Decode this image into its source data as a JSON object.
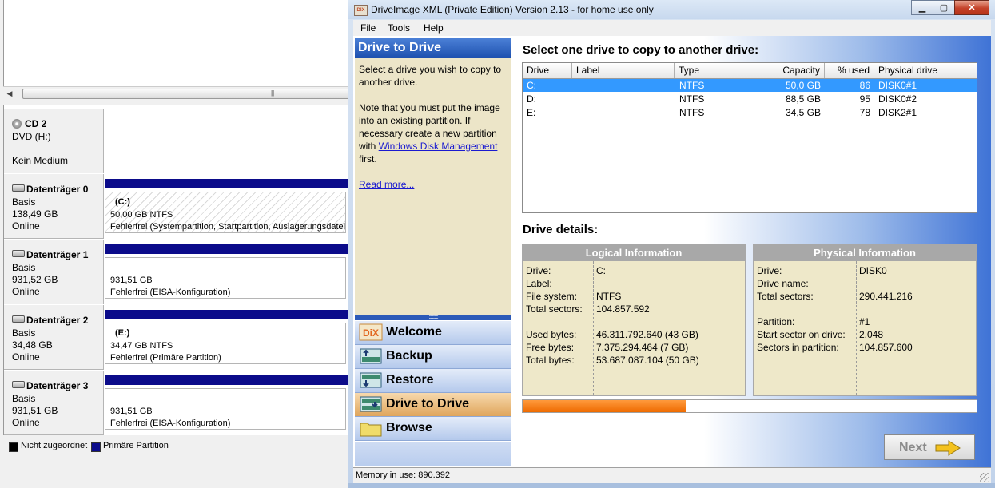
{
  "disk_management": {
    "scroll_grip": "|||",
    "disks": [
      {
        "name": "CD 2",
        "line1": "DVD (H:)",
        "line2": "",
        "line3": "Kein Medium",
        "part_title": "",
        "part_size": "",
        "part_status": ""
      },
      {
        "name": "Datenträger 0",
        "line1": "Basis",
        "line2": "138,49 GB",
        "line3": "Online",
        "part_title": "(C:)",
        "part_size": "50,00 GB NTFS",
        "part_status": "Fehlerfrei (Systempartition, Startpartition, Auslagerungsdatei"
      },
      {
        "name": "Datenträger 1",
        "line1": "Basis",
        "line2": "931,52 GB",
        "line3": "Online",
        "part_title": "",
        "part_size": "931,51 GB",
        "part_status": "Fehlerfrei (EISA-Konfiguration)"
      },
      {
        "name": "Datenträger 2",
        "line1": "Basis",
        "line2": "34,48 GB",
        "line3": "Online",
        "part_title": "(E:)",
        "part_size": "34,47 GB NTFS",
        "part_status": "Fehlerfrei (Primäre Partition)"
      },
      {
        "name": "Datenträger 3",
        "line1": "Basis",
        "line2": "931,51 GB",
        "line3": "Online",
        "part_title": "",
        "part_size": "931,51 GB",
        "part_status": "Fehlerfrei (EISA-Konfiguration)"
      }
    ],
    "legend": [
      {
        "label": "Nicht zugeordnet",
        "color": "#000000"
      },
      {
        "label": "Primäre Partition",
        "color": "#0b0b8a"
      }
    ]
  },
  "window": {
    "title": "DriveImage XML (Private Edition) Version 2.13 - for home use only",
    "icon_text": "DIX"
  },
  "menu": {
    "file": "File",
    "tools": "Tools",
    "help": "Help"
  },
  "sidebar": {
    "header": "Drive to Drive",
    "intro": "Select a drive you wish to copy to another drive.",
    "note_before_link": "Note that you must put the image into an existing partition. If necessary create a new partition with ",
    "link": "Windows Disk Management",
    "note_after_link": " first.",
    "read_more": "Read more...",
    "grip": "::::::::::::",
    "nav": [
      {
        "label": "Welcome",
        "icon": "dix-logo-icon"
      },
      {
        "label": "Backup",
        "icon": "backup-icon"
      },
      {
        "label": "Restore",
        "icon": "restore-icon"
      },
      {
        "label": "Drive to Drive",
        "icon": "drive-to-drive-icon",
        "active": true
      },
      {
        "label": "Browse",
        "icon": "folder-icon"
      }
    ]
  },
  "main": {
    "select_title": "Select one drive to copy to another drive:",
    "columns": [
      "Drive",
      "Label",
      "Type",
      "Capacity",
      "% used",
      "Physical drive"
    ],
    "drives": [
      {
        "drive": "C:",
        "label": "",
        "type": "NTFS",
        "capacity": "50,0 GB",
        "used": "86",
        "physical": "DISK0#1",
        "selected": true
      },
      {
        "drive": "D:",
        "label": "",
        "type": "NTFS",
        "capacity": "88,5 GB",
        "used": "95",
        "physical": "DISK0#2"
      },
      {
        "drive": "E:",
        "label": "",
        "type": "NTFS",
        "capacity": "34,5 GB",
        "used": "78",
        "physical": "DISK2#1"
      }
    ],
    "details_title": "Drive details:",
    "logical": {
      "header": "Logical Information",
      "rows": [
        {
          "k": "Drive:",
          "v": "C:"
        },
        {
          "k": "Label:",
          "v": ""
        },
        {
          "k": "File system:",
          "v": "NTFS"
        },
        {
          "k": "Total sectors:",
          "v": "104.857.592"
        },
        {
          "k": "Used bytes:",
          "v": "46.311.792.640 (43 GB)"
        },
        {
          "k": "Free bytes:",
          "v": "7.375.294.464 (7 GB)"
        },
        {
          "k": "Total bytes:",
          "v": "53.687.087.104 (50 GB)"
        }
      ]
    },
    "physical": {
      "header": "Physical Information",
      "rows": [
        {
          "k": "Drive:",
          "v": "DISK0"
        },
        {
          "k": "Drive name:",
          "v": ""
        },
        {
          "k": "Total sectors:",
          "v": "290.441.216"
        },
        {
          "k": "Partition:",
          "v": "#1"
        },
        {
          "k": "Start sector on drive:",
          "v": "2.048"
        },
        {
          "k": "Sectors in partition:",
          "v": "104.857.600"
        }
      ]
    },
    "progress": 0.36,
    "next_label": "Next"
  },
  "status": {
    "memory": "Memory in use: 890.392"
  },
  "colors": {
    "accent": "#1c4fae",
    "progress": "#ee6a00",
    "selection": "#3399ff",
    "active_nav": "#dfa55b"
  }
}
